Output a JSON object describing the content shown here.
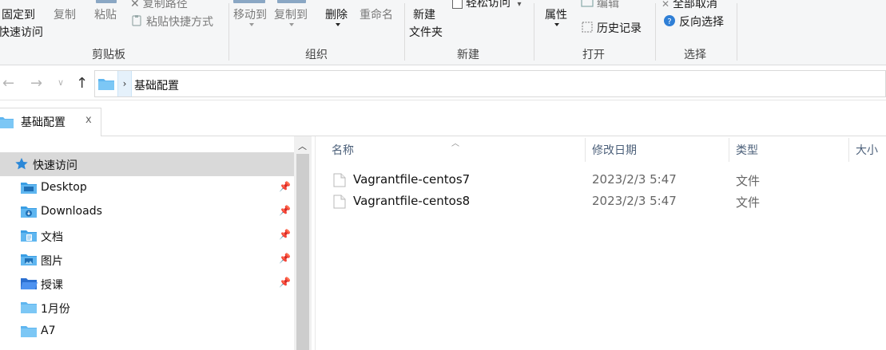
{
  "ribbon": {
    "clipboard": {
      "pin_to_quick_access_line1": "固定到",
      "pin_to_quick_access_line2": "快速访问",
      "copy": "复制",
      "paste": "粘贴",
      "copy_path": "复制路径",
      "paste_shortcut": "粘贴快捷方式",
      "group_label": "剪贴板"
    },
    "organize": {
      "move_to": "移动到",
      "copy_to": "复制到",
      "delete": "删除",
      "rename": "重命名",
      "group_label": "组织"
    },
    "new": {
      "new_folder_line1": "新建",
      "new_folder_line2": "文件夹",
      "easy_access": "轻松访问",
      "group_label": "新建"
    },
    "open": {
      "properties": "属性",
      "edit": "编辑",
      "history": "历史记录",
      "group_label": "打开"
    },
    "select": {
      "select_none": "全部取消",
      "invert_selection": "反向选择",
      "group_label": "选择"
    }
  },
  "address": {
    "path": "基础配置"
  },
  "tab": {
    "title": "基础配置",
    "close": "x"
  },
  "navigation": {
    "items": [
      {
        "label": "快速访问",
        "icon": "star-icon",
        "pinned": false,
        "selected": true
      },
      {
        "label": "Desktop",
        "icon": "desktop-folder-icon",
        "pinned": true
      },
      {
        "label": "Downloads",
        "icon": "downloads-folder-icon",
        "pinned": true
      },
      {
        "label": "文档",
        "icon": "documents-folder-icon",
        "pinned": true
      },
      {
        "label": "图片",
        "icon": "pictures-folder-icon",
        "pinned": true
      },
      {
        "label": "授课",
        "icon": "open-folder-icon",
        "pinned": true
      },
      {
        "label": "1月份",
        "icon": "folder-icon",
        "pinned": false
      },
      {
        "label": "A7",
        "icon": "folder-icon",
        "pinned": false
      }
    ]
  },
  "file_list": {
    "columns": {
      "name": "名称",
      "modified": "修改日期",
      "type": "类型",
      "size": "大小"
    },
    "rows": [
      {
        "name": "Vagrantfile-centos7",
        "modified": "2023/2/3 5:47",
        "type": "文件"
      },
      {
        "name": "Vagrantfile-centos8",
        "modified": "2023/2/3 5:47",
        "type": "文件"
      }
    ]
  },
  "colors": {
    "accent": "#0078d7",
    "folder": "#f8c84a",
    "selection": "#d9d9d9"
  }
}
